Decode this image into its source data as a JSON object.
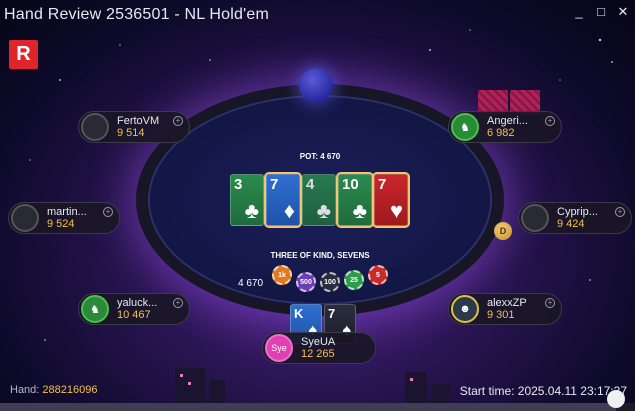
{
  "window": {
    "title": "Hand Review 2536501 - NL Hold'em",
    "minimize_glyph": "_",
    "maximize_glyph": "□",
    "close_glyph": "✕"
  },
  "logo": {
    "letter": "R",
    "color": "#e0242b"
  },
  "pot": {
    "label": "POT: 4 670",
    "stack_amount": "4 670"
  },
  "board_cards": [
    {
      "rank": "3",
      "suit": "♣",
      "color": "green"
    },
    {
      "rank": "7",
      "suit": "♦",
      "color": "blue"
    },
    {
      "rank": "4",
      "suit": "♣",
      "color": "green"
    },
    {
      "rank": "10",
      "suit": "♣",
      "color": "green"
    },
    {
      "rank": "7",
      "suit": "♥",
      "color": "red"
    }
  ],
  "hand_result": "THREE OF KIND, SEVENS",
  "chips": [
    {
      "label": "1k",
      "color": "#e07a1e"
    },
    {
      "label": "500",
      "color": "#6b3fb0"
    },
    {
      "label": "100",
      "color": "#2a2d3e"
    },
    {
      "label": "25",
      "color": "#2e9a4a"
    },
    {
      "label": "5",
      "color": "#c82a2a"
    }
  ],
  "players": [
    {
      "name": "FertoVM",
      "stack": "9 514",
      "avatar": "",
      "active": false
    },
    {
      "name": "martin...",
      "stack": "9 524",
      "avatar": "",
      "active": false
    },
    {
      "name": "yaluck...",
      "stack": "10 467",
      "avatar": "♞",
      "active": true
    },
    {
      "name": "Angeri...",
      "stack": "6 982",
      "avatar": "♞",
      "active": true
    },
    {
      "name": "Cyprip...",
      "stack": "9 424",
      "avatar": "",
      "active": false
    },
    {
      "name": "alexxZP",
      "stack": "9 301",
      "avatar": "☻",
      "active": false
    },
    {
      "name": "SyeUA",
      "stack": "12 265",
      "avatar": "Sye",
      "active": true
    }
  ],
  "hero_cards": [
    {
      "rank": "K",
      "suit": "♠",
      "color": "blue"
    },
    {
      "rank": "7",
      "suit": "♠",
      "color": "dark"
    }
  ],
  "dealer_button": "D",
  "footer": {
    "hand_label": "Hand: ",
    "hand_value": "288216096",
    "start_time": "Start time: 2025.04.11 23:17:37"
  },
  "replay_progress": 0.97
}
